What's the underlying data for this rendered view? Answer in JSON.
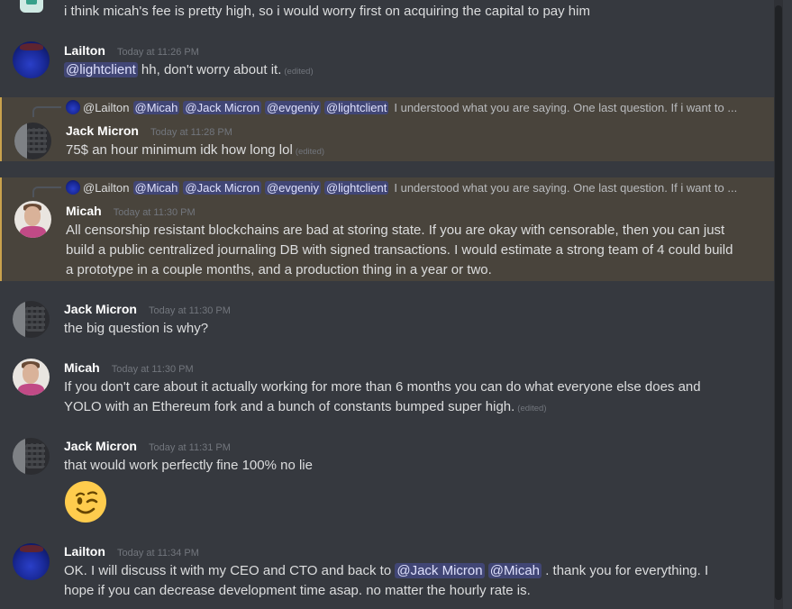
{
  "messages": [
    {
      "text": "i think micah's fee is pretty high, so i would worry first on acquiring the capital to pay him"
    },
    {
      "username": "Lailton",
      "timestamp": "Today at 11:26 PM",
      "mention": "@lightclient",
      "text": " hh, don't worry about it.",
      "edited": "(edited)"
    },
    {
      "reply": {
        "user": "@Lailton",
        "mentions": [
          "@Micah",
          "@Jack Micron",
          "@evgeniy",
          "@lightclient"
        ],
        "quote": "I understood what you are saying. One last question. If i want to ..."
      },
      "username": "Jack Micron",
      "timestamp": "Today at 11:28 PM",
      "text": "75$ an hour minimum idk how long lol",
      "edited": "(edited)"
    },
    {
      "reply": {
        "user": "@Lailton",
        "mentions": [
          "@Micah",
          "@Jack Micron",
          "@evgeniy",
          "@lightclient"
        ],
        "quote": "I understood what you are saying. One last question. If i want to ..."
      },
      "username": "Micah",
      "timestamp": "Today at 11:30 PM",
      "text": "All censorship resistant blockchains are bad at storing state.  If you are okay with censorable, then you can just build a public centralized journaling DB with signed transactions.  I would estimate a strong team of 4 could build a prototype in a couple months, and a production thing in a year or two."
    },
    {
      "username": "Jack Micron",
      "timestamp": "Today at 11:30 PM",
      "text": "the big question is why?"
    },
    {
      "username": "Micah",
      "timestamp": "Today at 11:30 PM",
      "text": "If you don't care about it actually working for more than 6 months you can do what everyone else does and YOLO with an Ethereum fork and a bunch of constants bumped super high.",
      "edited": "(edited)"
    },
    {
      "username": "Jack Micron",
      "timestamp": "Today at 11:31 PM",
      "text": "that would work perfectly fine 100% no lie",
      "emoji": "winking-face"
    },
    {
      "username": "Lailton",
      "timestamp": "Today at 11:34 PM",
      "text_before": "OK. I will discuss it with my CEO and CTO and back to ",
      "mention1": "@Jack Micron",
      "mention2": "@Micah",
      "text_after": " . thank you for everything. I hope if you can decrease development time asap. no matter the hourly rate is."
    }
  ],
  "colors": {
    "background": "#36393f",
    "highlight": "#49443c",
    "highlight_border": "#c9a24d",
    "mention_bg": "#414675",
    "mention_text": "#dee0fc",
    "username": "#ffffff",
    "text": "#dcddde",
    "timestamp": "#72767d"
  }
}
